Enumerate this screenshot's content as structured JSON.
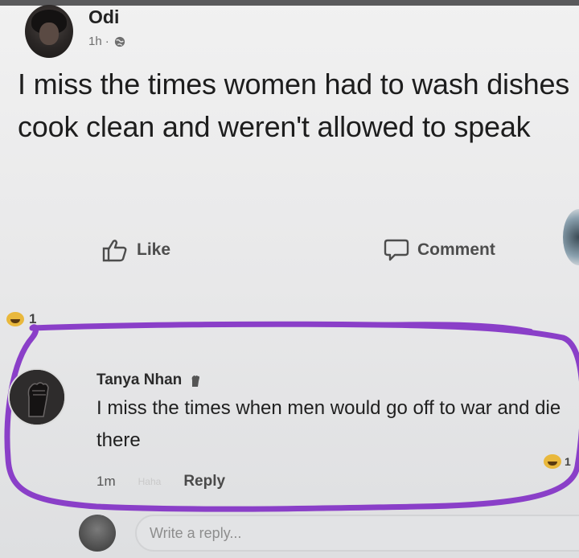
{
  "post": {
    "author": "Odi",
    "time": "1h",
    "separator": "·",
    "text": "I miss the times women had to wash dishes cook clean and weren't allowed to speak",
    "privacy_icon": "globe-icon"
  },
  "actions": {
    "like_label": "Like",
    "comment_label": "Comment"
  },
  "reactions": {
    "post_count": "1",
    "comment_count": "1",
    "icon": "laughing-emoji-icon"
  },
  "comment": {
    "author": "Tanya Nhan",
    "badge_icon": "raised-fist-icon",
    "text": "I miss the times when men would go off to war and die there",
    "time": "1m",
    "haha_label": "Haha",
    "reply_label": "Reply"
  },
  "reply_box": {
    "placeholder": "Write a reply..."
  },
  "colors": {
    "highlight_outline": "#8a3fc8",
    "background": "#ececec",
    "text": "#1d1d1d"
  }
}
